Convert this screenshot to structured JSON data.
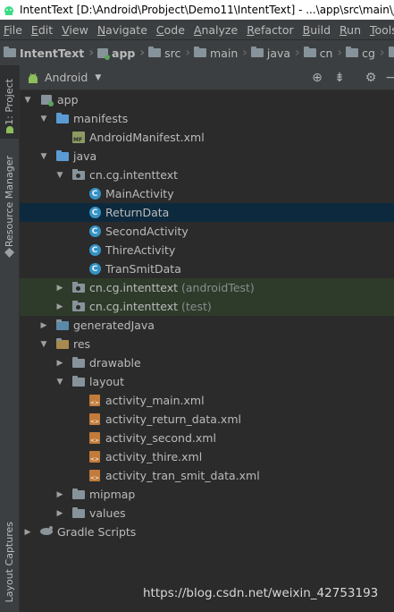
{
  "window": {
    "title": "IntentText [D:\\Android\\Probject\\Demo11\\IntentText] - ...\\app\\src\\main\\java\\cn\\cg\\intenttext\\ReturnData.java [app] - Android Studio"
  },
  "menu": [
    "File",
    "Edit",
    "View",
    "Navigate",
    "Code",
    "Analyze",
    "Refactor",
    "Build",
    "Run",
    "Tools"
  ],
  "breadcrumb": [
    {
      "label": "IntentText",
      "icon": "folder-icon"
    },
    {
      "label": "app",
      "icon": "module-icon"
    },
    {
      "label": "src",
      "icon": "folder-icon"
    },
    {
      "label": "main",
      "icon": "folder-icon"
    },
    {
      "label": "java",
      "icon": "folder-icon"
    },
    {
      "label": "cn",
      "icon": "folder-icon"
    },
    {
      "label": "cg",
      "icon": "folder-icon"
    },
    {
      "label": "in",
      "icon": "folder-icon"
    }
  ],
  "side_tabs": {
    "project": "1: Project",
    "resource_manager": "Resource Manager",
    "layout_captures": "Layout Captures"
  },
  "project_toolbar": {
    "view_mode": "Android"
  },
  "tree": [
    {
      "label": "app",
      "icon": "module",
      "expanded": true
    },
    {
      "label": "manifests",
      "icon": "folder-blue",
      "expanded": true
    },
    {
      "label": "AndroidManifest.xml",
      "icon": "manifest"
    },
    {
      "label": "java",
      "icon": "folder-blue",
      "expanded": true
    },
    {
      "label": "cn.cg.intenttext",
      "icon": "package",
      "expanded": true
    },
    {
      "label": "MainActivity",
      "icon": "class"
    },
    {
      "label": "ReturnData",
      "icon": "class",
      "selected": true
    },
    {
      "label": "SecondActivity",
      "icon": "class"
    },
    {
      "label": "ThireActivity",
      "icon": "class"
    },
    {
      "label": "TranSmitData",
      "icon": "class"
    },
    {
      "label": "cn.cg.intenttext",
      "suffix": "(androidTest)",
      "icon": "package",
      "expanded": false
    },
    {
      "label": "cn.cg.intenttext",
      "suffix": "(test)",
      "icon": "package",
      "expanded": false
    },
    {
      "label": "generatedJava",
      "icon": "folder-gen",
      "expanded": false
    },
    {
      "label": "res",
      "icon": "folder-res",
      "expanded": true
    },
    {
      "label": "drawable",
      "icon": "folder",
      "expanded": false
    },
    {
      "label": "layout",
      "icon": "folder",
      "expanded": true
    },
    {
      "label": "activity_main.xml",
      "icon": "xml"
    },
    {
      "label": "activity_return_data.xml",
      "icon": "xml"
    },
    {
      "label": "activity_second.xml",
      "icon": "xml"
    },
    {
      "label": "activity_thire.xml",
      "icon": "xml"
    },
    {
      "label": "activity_tran_smit_data.xml",
      "icon": "xml"
    },
    {
      "label": "mipmap",
      "icon": "folder",
      "expanded": false
    },
    {
      "label": "values",
      "icon": "folder",
      "expanded": false
    },
    {
      "label": "Gradle Scripts",
      "icon": "gradle",
      "expanded": false
    }
  ],
  "watermark": "https://blog.csdn.net/weixin_42753193",
  "colors": {
    "selection": "#0d293e",
    "test_row": "#2e3b2a",
    "class_icon": "#3592c4",
    "xml_icon": "#c27b3a"
  }
}
